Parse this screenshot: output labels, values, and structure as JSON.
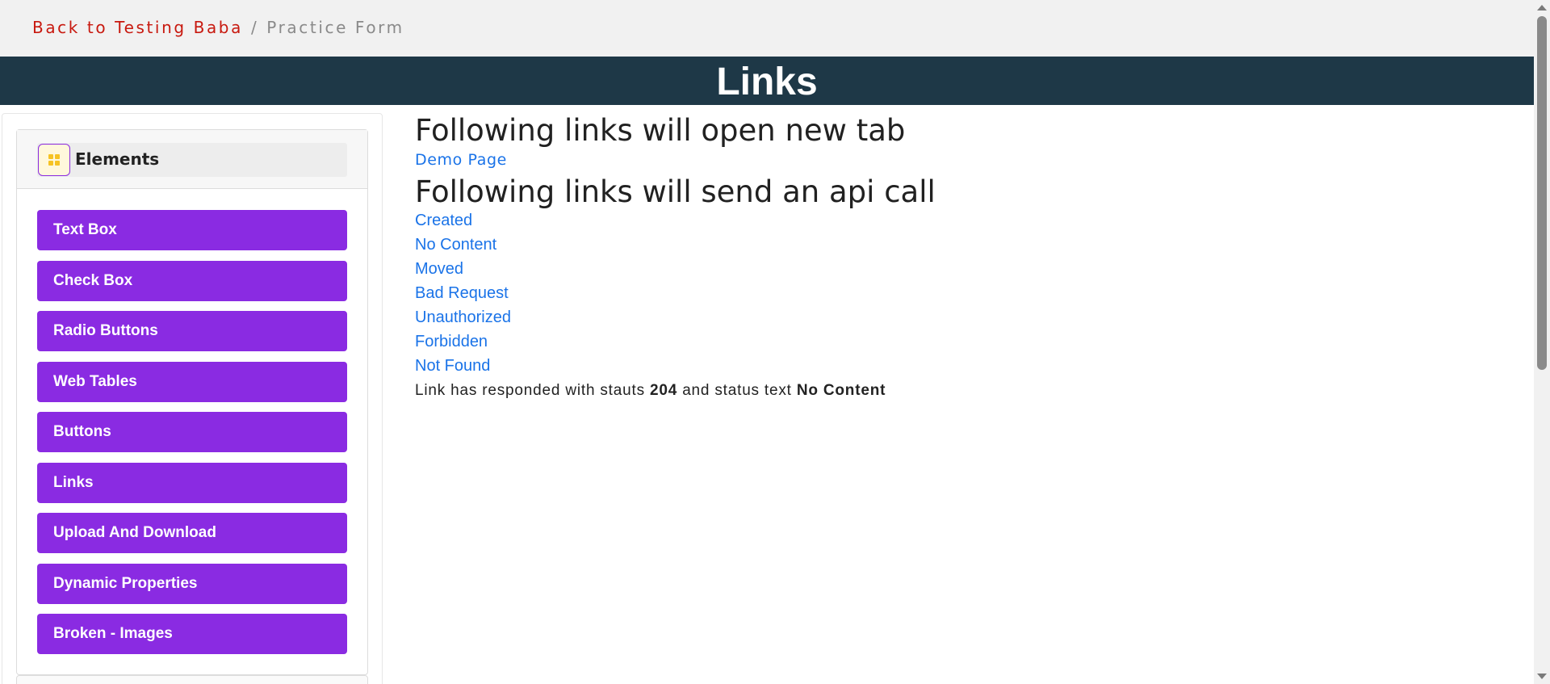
{
  "breadcrumb": {
    "back_link": "Back to Testing Baba",
    "separator": "/",
    "current": "Practice Form"
  },
  "banner": {
    "title": "Links"
  },
  "sidebar": {
    "group": {
      "title": "Elements",
      "icon": "grid-icon"
    },
    "items": [
      {
        "label": "Text Box"
      },
      {
        "label": "Check Box"
      },
      {
        "label": "Radio Buttons"
      },
      {
        "label": "Web Tables"
      },
      {
        "label": "Buttons"
      },
      {
        "label": "Links"
      },
      {
        "label": "Upload And Download"
      },
      {
        "label": "Dynamic Properties"
      },
      {
        "label": "Broken - Images"
      }
    ]
  },
  "main": {
    "new_tab_heading": "Following links will open new tab",
    "new_tab_links": [
      "Demo Page"
    ],
    "api_heading": "Following links will send an api call",
    "api_links": [
      "Created",
      "No Content",
      "Moved",
      "Bad Request",
      "Unauthorized",
      "Forbidden",
      "Not Found"
    ],
    "response": {
      "prefix": "Link has responded with stauts",
      "status_code": "204",
      "middle": "and status text",
      "status_text": "No Content"
    }
  },
  "colors": {
    "banner_bg": "#1e3847",
    "nav_button": "#8a2be2",
    "link": "#1a73e8",
    "breadcrumb_link": "#c8190f"
  }
}
